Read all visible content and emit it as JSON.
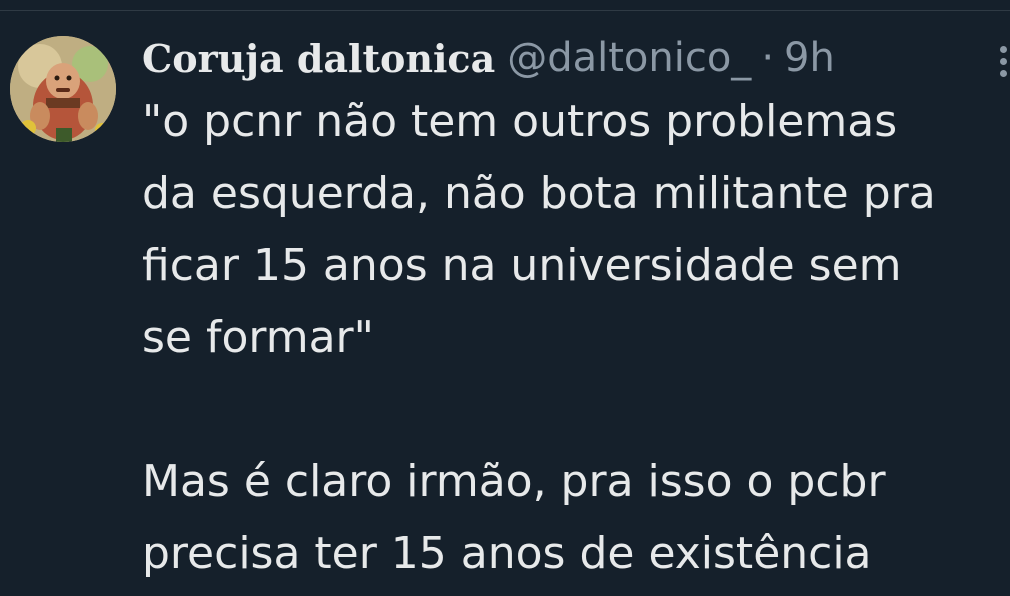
{
  "tweet": {
    "author": {
      "display_name": "Coruja daltonica",
      "handle": "@daltonico_",
      "avatar_icon": "avatar-image"
    },
    "separator": "·",
    "time": "9h",
    "more_icon": "more-options-icon",
    "text_lines": [
      "\"o pcnr não tem outros problemas",
      "da esquerda, não bota militante pra",
      "ficar 15 anos na universidade sem",
      "se formar\"",
      "",
      "Mas é claro irmão, pra isso o pcbr",
      "precisa ter 15 anos de existência"
    ]
  },
  "colors": {
    "background": "#15202b",
    "primary_text": "#e7e9ea",
    "secondary_text": "#8b98a5"
  }
}
